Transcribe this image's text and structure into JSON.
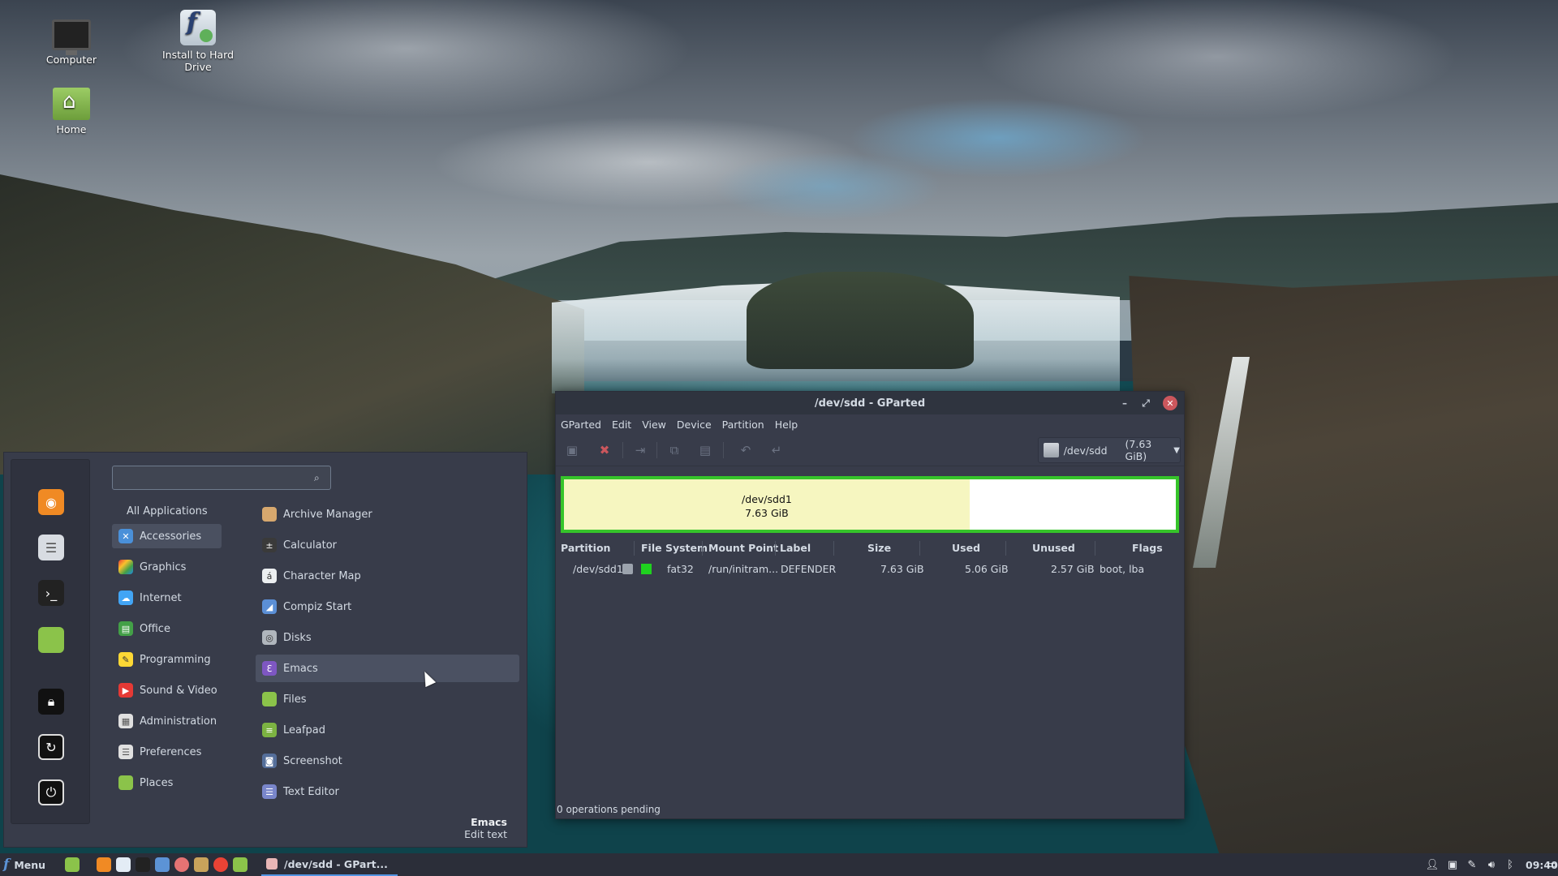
{
  "desktop": {
    "icons": [
      {
        "label": "Computer",
        "icon": "computer-icon"
      },
      {
        "label": "Install to Hard Drive",
        "icon": "install-icon"
      },
      {
        "label": "Home",
        "icon": "home-folder-icon"
      }
    ]
  },
  "start_menu": {
    "search": {
      "value": "",
      "placeholder": ""
    },
    "favorites": [
      "firefox-icon",
      "settings-icon",
      "terminal-icon",
      "folder-icon",
      "lock-icon",
      "logout-icon",
      "power-icon"
    ],
    "categories": [
      {
        "label": "All Applications"
      },
      {
        "label": "Accessories",
        "selected": true
      },
      {
        "label": "Graphics"
      },
      {
        "label": "Internet"
      },
      {
        "label": "Office"
      },
      {
        "label": "Programming"
      },
      {
        "label": "Sound & Video"
      },
      {
        "label": "Administration"
      },
      {
        "label": "Preferences"
      },
      {
        "label": "Places"
      }
    ],
    "apps": [
      {
        "label": "Archive Manager"
      },
      {
        "label": "Calculator"
      },
      {
        "label": "Character Map"
      },
      {
        "label": "Compiz Start"
      },
      {
        "label": "Disks"
      },
      {
        "label": "Emacs",
        "hovered": true
      },
      {
        "label": "Files"
      },
      {
        "label": "Leafpad"
      },
      {
        "label": "Screenshot"
      },
      {
        "label": "Text Editor"
      }
    ],
    "footer": {
      "title": "Emacs",
      "description": "Edit text"
    }
  },
  "gparted": {
    "title": "/dev/sdd - GParted",
    "menu": [
      "GParted",
      "Edit",
      "View",
      "Device",
      "Partition",
      "Help"
    ],
    "device": {
      "name": "/dev/sdd",
      "size": "(7.63 GiB)"
    },
    "partition_map": {
      "name": "/dev/sdd1",
      "size": "7.63 GiB",
      "used_fraction": 0.663
    },
    "columns": [
      "Partition",
      "File System",
      "Mount Point",
      "Label",
      "Size",
      "Used",
      "Unused",
      "Flags"
    ],
    "rows": [
      {
        "partition": "/dev/sdd1",
        "file_system": "fat32",
        "mount_point": "/run/initram...",
        "label": "DEFENDER",
        "size": "7.63 GiB",
        "used": "5.06 GiB",
        "unused": "2.57 GiB",
        "flags": "boot, lba"
      }
    ],
    "status": "0 operations pending",
    "fs_color": "#1fd11f"
  },
  "taskbar": {
    "menu_label": "Menu",
    "active_task": "/dev/sdd - GPart...",
    "clock": "09:40"
  },
  "colors": {
    "accent": "#5294e2",
    "partition_border": "#36c42a",
    "close_button": "#cc575d"
  }
}
